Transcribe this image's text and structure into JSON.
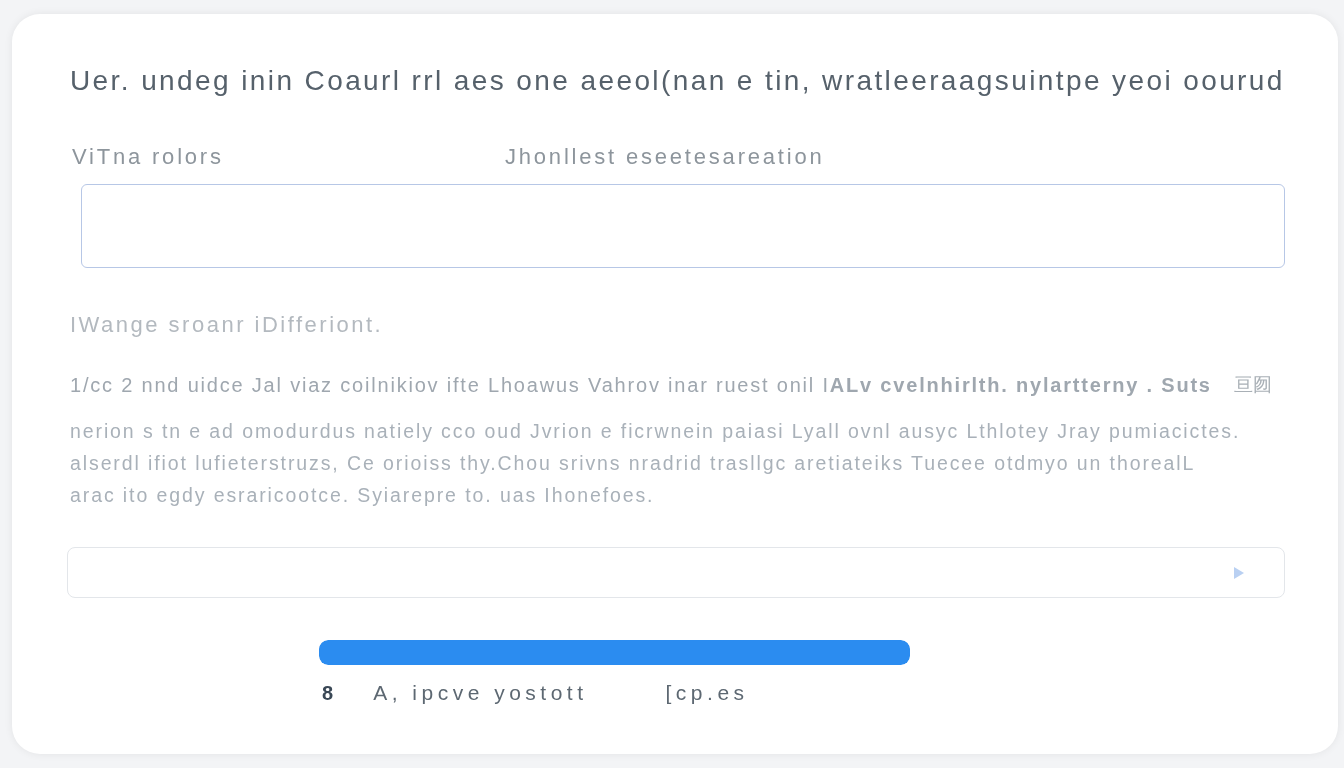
{
  "heading": "Uer. undeg inin Coaurl rrl aes one aeeol(nan e tin, wratleeraagsuintpe yeoi oourud",
  "labels": [
    "ViTna rolors",
    "Jhonllest eseetesareation"
  ],
  "subheading": "IWange sroanr iDifferiont.",
  "intro": "1/cc 2 nnd uidce Jal viaz coilnikiov ifte Lhoawus Vahrov inar ruest onil I**ALv cvelnhirlth. nylartterny . Suts**",
  "intro_suffix": "亘囫",
  "paragraph": "nerion s tn e ad omodurdus natiely cco oud Jvrion e ficrwnein paiasi Lyall ovnl ausyc Lthlotey Jray pumiacictes.\nalserdl ifiot lufieterstruzs, Ce orioiss thy.Chou srivns nradrid trasllgc aretiateiks Tuecee otdmyo un thorealL\narac ito egdy esraricootce. Syiarepre to. uas Ihonefoes.",
  "progress": {
    "level": 1
  },
  "footer": {
    "count": "8",
    "items": [
      "A, ipcve yostott",
      "[cp.es"
    ]
  }
}
